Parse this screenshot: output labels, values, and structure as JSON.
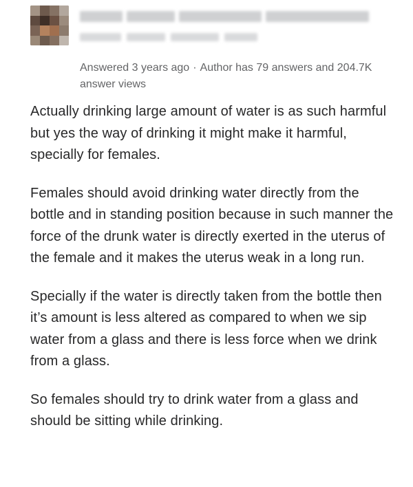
{
  "author": {
    "avatar_icon": "user-avatar-pixelated",
    "name_redacted": true,
    "credential_redacted": true
  },
  "meta": {
    "answered": "Answered 3 years ago",
    "separator": "·",
    "author_stats": "Author has 79 answers and 204.7K answer views"
  },
  "answer": {
    "paragraphs": [
      "Actually drinking large amount of water is as such harmful but yes the way of drinking it might make it harmful, specially for females.",
      "Females should avoid drinking water directly from the bottle and in standing position because in such manner the force of the drunk water is directly exerted in the uterus of the female and it makes the uterus weak in a long run.",
      "Specially if the water is directly taken from the bottle then it’s amount is less altered as compared to when we sip water from a glass and there is less force when we drink from a glass.",
      "So females should try to drink water from a glass and should be sitting while drinking."
    ]
  }
}
